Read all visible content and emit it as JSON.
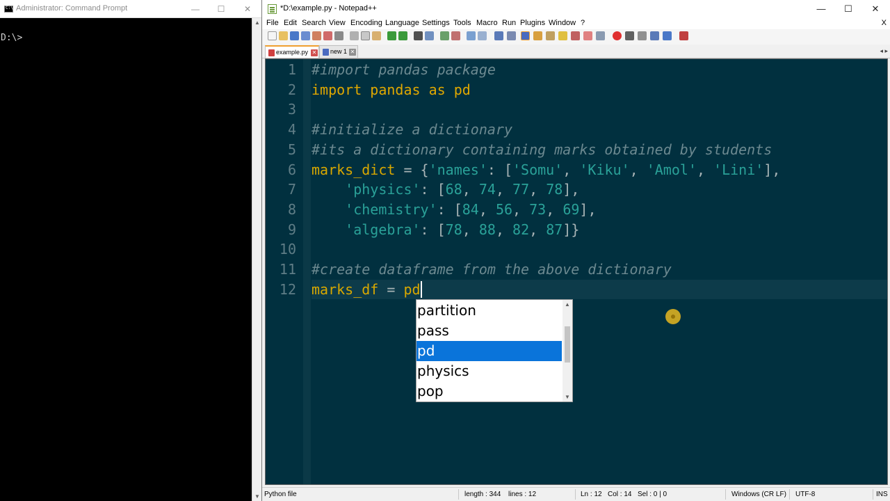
{
  "cmd": {
    "title": "Administrator: Command Prompt",
    "prompt": "D:\\>",
    "minimize": "—",
    "maximize": "☐",
    "close": "✕"
  },
  "notepad": {
    "title": "*D:\\example.py - Notepad++",
    "minimize": "—",
    "maximize": "☐",
    "close": "✕",
    "menu": [
      "File",
      "Edit",
      "Search",
      "View",
      "Encoding",
      "Language",
      "Settings",
      "Tools",
      "Macro",
      "Run",
      "Plugins",
      "Window",
      "?"
    ],
    "menu_close": "X",
    "tabs": [
      {
        "label": "example.py",
        "active": true
      },
      {
        "label": "new 1",
        "active": false
      }
    ],
    "tab_close": "✕",
    "tab_scroll": "◂ ▸"
  },
  "editor": {
    "line_numbers": [
      "1",
      "2",
      "3",
      "4",
      "5",
      "6",
      "7",
      "8",
      "9",
      "10",
      "11",
      "12"
    ],
    "lines": [
      [
        {
          "t": "#import pandas package",
          "c": "comment"
        }
      ],
      [
        {
          "t": "import pandas as pd",
          "c": "kw"
        }
      ],
      [],
      [
        {
          "t": "#initialize a dictionary",
          "c": "comment"
        }
      ],
      [
        {
          "t": "#its a dictionary containing marks obtained by students",
          "c": "comment"
        }
      ],
      [
        {
          "t": "marks_dict",
          "c": "id"
        },
        {
          "t": " = {",
          "c": "op"
        },
        {
          "t": "'names'",
          "c": "str"
        },
        {
          "t": ": [",
          "c": "op"
        },
        {
          "t": "'Somu'",
          "c": "str"
        },
        {
          "t": ", ",
          "c": "op"
        },
        {
          "t": "'Kiku'",
          "c": "str"
        },
        {
          "t": ", ",
          "c": "op"
        },
        {
          "t": "'Amol'",
          "c": "str"
        },
        {
          "t": ", ",
          "c": "op"
        },
        {
          "t": "'Lini'",
          "c": "str"
        },
        {
          "t": "],",
          "c": "op"
        }
      ],
      [
        {
          "t": "    ",
          "c": "op"
        },
        {
          "t": "'physics'",
          "c": "str"
        },
        {
          "t": ": [",
          "c": "op"
        },
        {
          "t": "68",
          "c": "num"
        },
        {
          "t": ", ",
          "c": "op"
        },
        {
          "t": "74",
          "c": "num"
        },
        {
          "t": ", ",
          "c": "op"
        },
        {
          "t": "77",
          "c": "num"
        },
        {
          "t": ", ",
          "c": "op"
        },
        {
          "t": "78",
          "c": "num"
        },
        {
          "t": "],",
          "c": "op"
        }
      ],
      [
        {
          "t": "    ",
          "c": "op"
        },
        {
          "t": "'chemistry'",
          "c": "str"
        },
        {
          "t": ": [",
          "c": "op"
        },
        {
          "t": "84",
          "c": "num"
        },
        {
          "t": ", ",
          "c": "op"
        },
        {
          "t": "56",
          "c": "num"
        },
        {
          "t": ", ",
          "c": "op"
        },
        {
          "t": "73",
          "c": "num"
        },
        {
          "t": ", ",
          "c": "op"
        },
        {
          "t": "69",
          "c": "num"
        },
        {
          "t": "],",
          "c": "op"
        }
      ],
      [
        {
          "t": "    ",
          "c": "op"
        },
        {
          "t": "'algebra'",
          "c": "str"
        },
        {
          "t": ": [",
          "c": "op"
        },
        {
          "t": "78",
          "c": "num"
        },
        {
          "t": ", ",
          "c": "op"
        },
        {
          "t": "88",
          "c": "num"
        },
        {
          "t": ", ",
          "c": "op"
        },
        {
          "t": "82",
          "c": "num"
        },
        {
          "t": ", ",
          "c": "op"
        },
        {
          "t": "87",
          "c": "num"
        },
        {
          "t": "]}",
          "c": "op"
        }
      ],
      [],
      [
        {
          "t": "#create dataframe from the above dictionary",
          "c": "comment"
        }
      ],
      [
        {
          "t": "marks_df",
          "c": "id"
        },
        {
          "t": " = ",
          "c": "op"
        },
        {
          "t": "pd",
          "c": "id"
        }
      ]
    ],
    "current_line": 12,
    "colors": {
      "background": "#01303f",
      "comment": "#6c8990",
      "keyword": "#e0a800",
      "string": "#2aa198",
      "selection": "#0a74da"
    }
  },
  "autocomplete": {
    "items": [
      "partition",
      "pass",
      "pd",
      "physics",
      "pop"
    ],
    "selected": "pd"
  },
  "status": {
    "file_type": "Python file",
    "length": "length : 344",
    "lines": "lines : 12",
    "ln": "Ln : 12",
    "col": "Col : 14",
    "sel": "Sel : 0 | 0",
    "eol": "Windows (CR LF)",
    "encoding": "UTF-8",
    "mode": "INS"
  }
}
